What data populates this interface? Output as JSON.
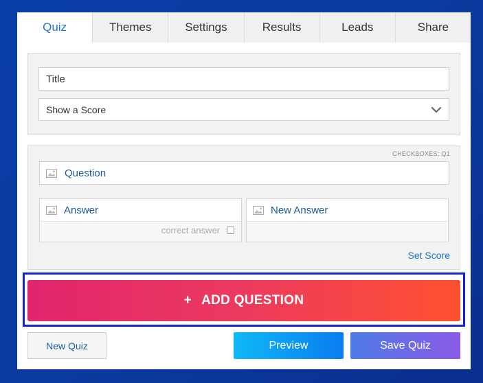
{
  "tabs": [
    {
      "label": "Quiz",
      "active": true
    },
    {
      "label": "Themes"
    },
    {
      "label": "Settings"
    },
    {
      "label": "Results"
    },
    {
      "label": "Leads"
    },
    {
      "label": "Share"
    }
  ],
  "quiz_settings": {
    "title_placeholder": "Title",
    "score_select_value": "Show a Score"
  },
  "question_card": {
    "type_tag": "CHECKBOXES: Q1",
    "question_placeholder": "Question",
    "answers": [
      {
        "label": "Answer",
        "correct_label": "correct answer"
      },
      {
        "label": "New Answer"
      }
    ],
    "set_score_label": "Set Score"
  },
  "add_question": {
    "plus": "+",
    "label": "ADD QUESTION"
  },
  "footer": {
    "new_quiz_label": "New Quiz",
    "preview_label": "Preview",
    "save_label": "Save Quiz"
  },
  "colors": {
    "accent": "#1a73c8",
    "add_gradient_start": "#e0266e",
    "add_gradient_end": "#ff5130",
    "highlight_border": "#1522d6"
  }
}
